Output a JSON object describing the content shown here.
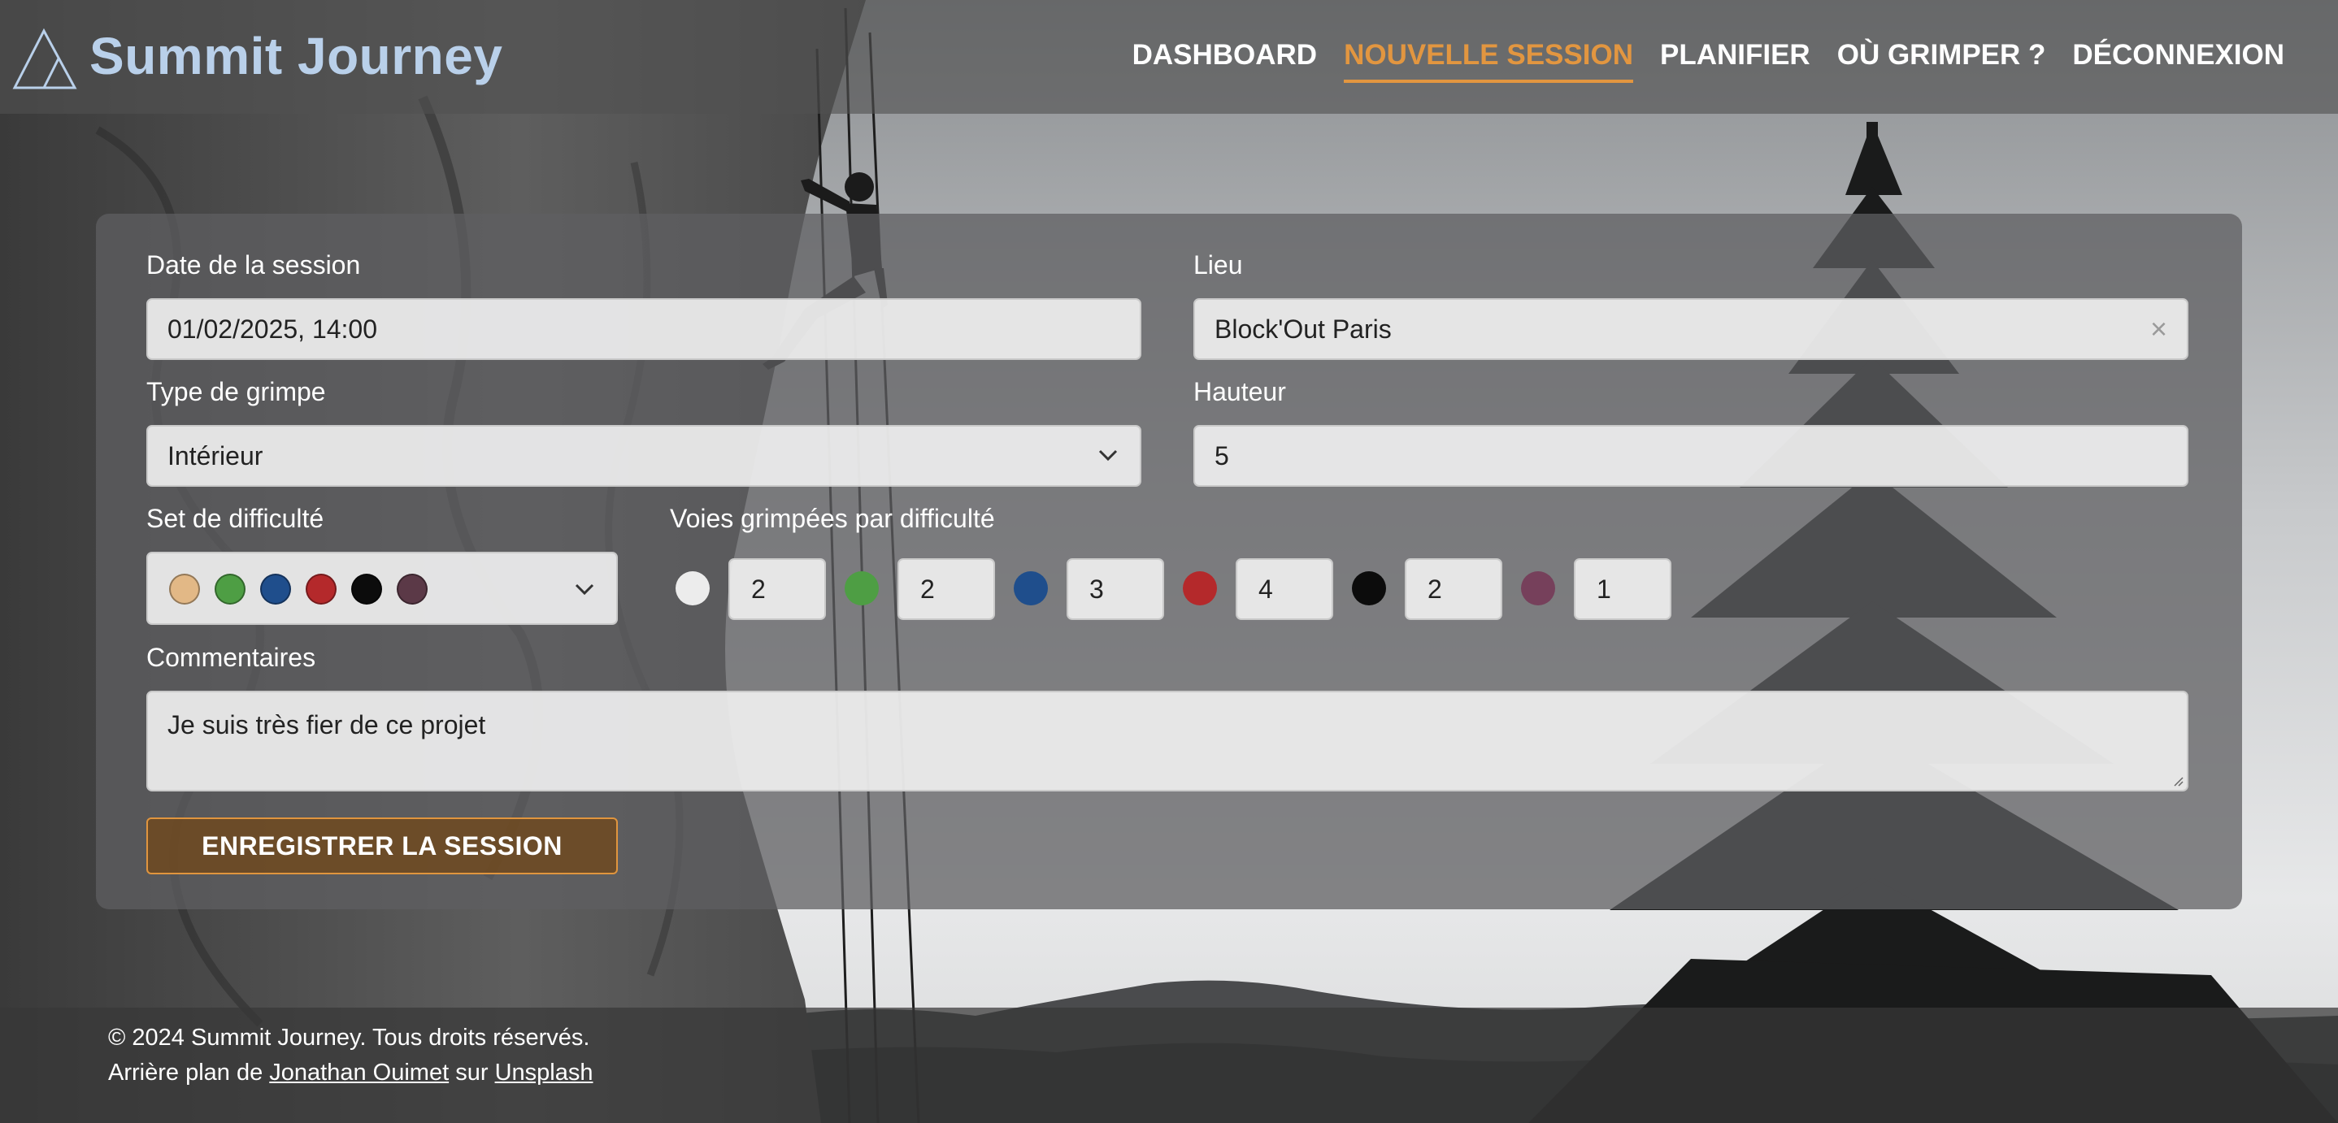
{
  "header": {
    "brand": "Summit Journey",
    "nav": [
      {
        "label": "DASHBOARD",
        "active": false
      },
      {
        "label": "NOUVELLE SESSION",
        "active": true
      },
      {
        "label": "PLANIFIER",
        "active": false
      },
      {
        "label": "OÙ GRIMPER ?",
        "active": false
      },
      {
        "label": "DÉCONNEXION",
        "active": false
      }
    ]
  },
  "form": {
    "date_label": "Date de la session",
    "date_value": "01/02/2025, 14:00",
    "lieu_label": "Lieu",
    "lieu_value": "Block'Out Paris",
    "lieu_clear": "×",
    "type_label": "Type de grimpe",
    "type_value": "Intérieur",
    "hauteur_label": "Hauteur",
    "hauteur_value": "5",
    "set_label": "Set de difficulté",
    "set_colors": [
      "#e2b886",
      "#4e9e44",
      "#1f4e8c",
      "#b4292b",
      "#0c0c0c",
      "#5b3947"
    ],
    "voies_label": "Voies grimpées par difficulté",
    "voies": [
      {
        "color": "#ececec",
        "count": "2"
      },
      {
        "color": "#4e9e44",
        "count": "2"
      },
      {
        "color": "#1f4e8c",
        "count": "3"
      },
      {
        "color": "#b4292b",
        "count": "4"
      },
      {
        "color": "#0c0c0c",
        "count": "2"
      },
      {
        "color": "#76405b",
        "count": "1"
      }
    ],
    "comment_label": "Commentaires",
    "comment_value": "Je suis très fier de ce projet",
    "submit_label": "ENREGISTRER LA SESSION"
  },
  "footer": {
    "copyright": "© 2024 Summit Journey. Tous droits réservés.",
    "credit_prefix": "Arrière plan de",
    "photographer": "Jonathan Ouimet",
    "credit_mid": "sur",
    "source": "Unsplash"
  },
  "colors": {
    "accent": "#e29640",
    "brand": "#b9d0ea"
  }
}
